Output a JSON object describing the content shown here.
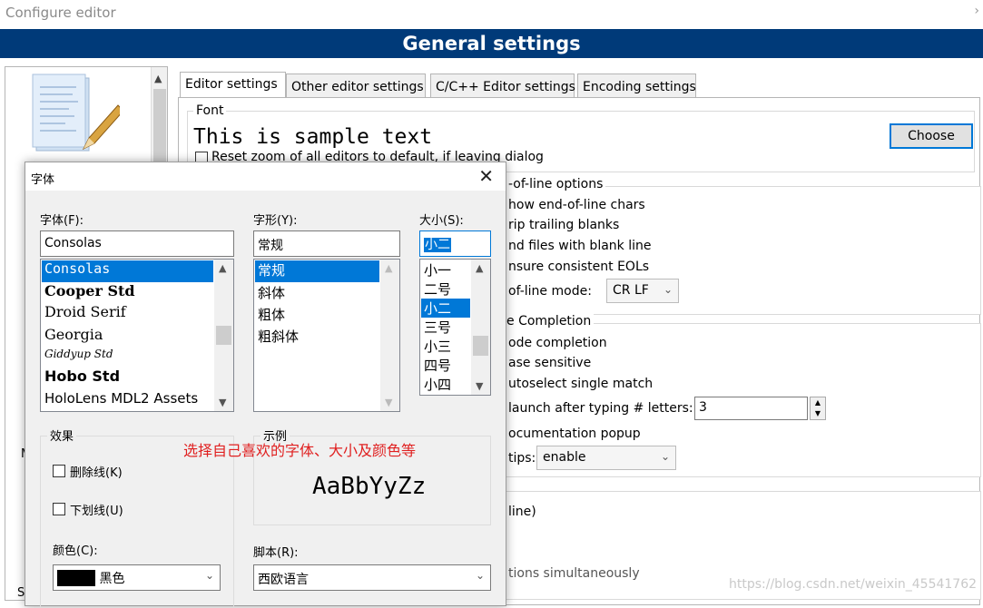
{
  "window": {
    "title": "Configure editor",
    "close_glyph": "›"
  },
  "banner": {
    "title": "General settings"
  },
  "nav": {
    "cut_label_1": "M",
    "cut_label_2": "S"
  },
  "tabs": [
    {
      "label": "Editor settings"
    },
    {
      "label": "Other editor settings"
    },
    {
      "label": "C/C++ Editor settings"
    },
    {
      "label": "Encoding settings"
    }
  ],
  "font_group": {
    "legend": "Font",
    "sample": "This is sample text",
    "choose_label": "Choose",
    "reset_zoom_label": "Reset zoom of all editors to default, if leaving dialog"
  },
  "eol_group": {
    "legend": "-of-line options",
    "show_eol": "how end-of-line chars",
    "strip_blanks": "rip trailing blanks",
    "end_blank_line": "nd files with blank line",
    "consistent_eols": "nsure consistent EOLs",
    "mode_label": "of-line mode:",
    "mode_value": "CR LF"
  },
  "completion_group": {
    "legend": "e Completion",
    "code_completion": "ode completion",
    "case_sensitive": "ase sensitive",
    "autoselect": "utoselect single match",
    "launch_label": "launch after typing # letters:",
    "launch_value": "3",
    "doc_popup": "ocumentation popup",
    "tips_label": "tips:",
    "tips_value": "enable"
  },
  "other_group": {
    "line_text": "line)",
    "simultaneous_text": "tions simultaneously"
  },
  "font_dialog": {
    "title": "字体",
    "font_label": "字体(F):",
    "font_value": "Consolas",
    "fonts": [
      "Consolas",
      "Cooper Std",
      "Droid Serif",
      "Georgia",
      "Giddyup Std",
      "Hobo Std",
      "HoloLens MDL2 Assets"
    ],
    "style_label": "字形(Y):",
    "style_value": "常规",
    "styles": [
      "常规",
      "斜体",
      "粗体",
      "粗斜体"
    ],
    "size_label": "大小(S):",
    "size_value": "小二",
    "sizes": [
      "小一",
      "二号",
      "小二",
      "三号",
      "小三",
      "四号",
      "小四"
    ],
    "effects_legend": "效果",
    "strikeout_label": "删除线(K)",
    "underline_label": "下划线(U)",
    "color_label": "颜色(C):",
    "color_value": "黑色",
    "sample_legend": "示例",
    "sample_text": "AaBbYyZz",
    "script_label": "脚本(R):",
    "script_value": "西欧语言",
    "annotation": "选择自己喜欢的字体、大小及颜色等",
    "colors": {
      "selection": "#0078d7",
      "annotation": "#e02020",
      "swatch": "#000000"
    }
  },
  "watermark": "https://blog.csdn.net/weixin_45541762",
  "colors": {
    "banner": "#003a79"
  }
}
